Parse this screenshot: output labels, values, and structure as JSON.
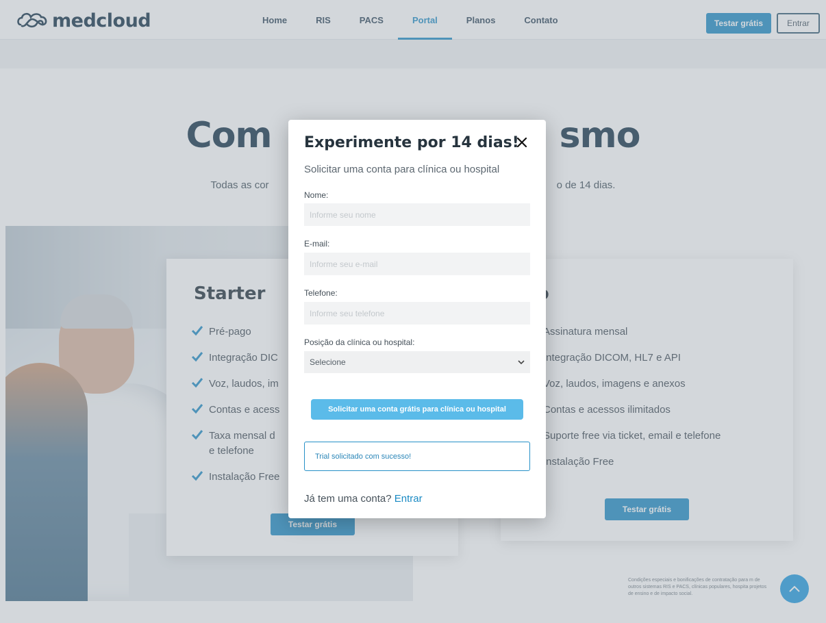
{
  "brand": {
    "name": "medcloud"
  },
  "nav": {
    "items": [
      {
        "label": "Home"
      },
      {
        "label": "RIS"
      },
      {
        "label": "PACS"
      },
      {
        "label": "Portal",
        "active": true
      },
      {
        "label": "Planos"
      },
      {
        "label": "Contato"
      }
    ],
    "trial_label": "Testar grátis",
    "login_label": "Entrar"
  },
  "hero": {
    "title_left": "Com",
    "title_right": "smo",
    "subtitle_left": "Todas as cor",
    "subtitle_right": "o de 14 dias."
  },
  "plans": [
    {
      "title": "Starter",
      "features": [
        "Pré-pago",
        "Integração DIC",
        "Voz, laudos, im",
        "Contas e acess",
        "Taxa mensal d\ne telefone",
        "Instalação Free"
      ],
      "button_label": "Testar grátis"
    },
    {
      "title": "ro",
      "features": [
        "Assinatura mensal",
        "Integração DICOM, HL7 e API",
        "Voz, laudos, imagens e anexos",
        "Contas e acessos ilimitados",
        "Suporte free via ticket, email e telefone",
        "Instalação Free"
      ],
      "button_label": "Testar grátis"
    }
  ],
  "footnote": "Condições especiais e bonificações de contratação para m de outros sistemas RIS e PACS, clínicas populares, hospita projetos de ensino e de impacto social.",
  "modal": {
    "title": "Experimente por 14 dias!",
    "subtitle": "Solicitar uma conta para clínica ou hospital",
    "fields": {
      "name": {
        "label": "Nome:",
        "placeholder": "Informe seu nome",
        "value": ""
      },
      "email": {
        "label": "E-mail:",
        "placeholder": "Informe seu e-mail",
        "value": ""
      },
      "phone": {
        "label": "Telefone:",
        "placeholder": "Informe seu telefone",
        "value": ""
      },
      "position": {
        "label": "Posição da clínica ou hospital:",
        "selected": "Selecione"
      }
    },
    "submit_label": "Solicitar uma conta grátis para clínica ou hospital",
    "success_message": "Trial solicitado com sucesso!",
    "login_prompt": "Já tem uma conta?",
    "login_link": "Entrar"
  },
  "colors": {
    "accent": "#1a8ac4",
    "accent_light": "#5bbbe9",
    "navy": "#0f2d44",
    "overlay": "rgba(150,160,170,0.42)"
  },
  "icons": {
    "logo": "cloud-infinity-icon",
    "close": "close-icon",
    "select": "chevron-down-icon",
    "check": "check-icon",
    "scroll_top": "chevron-up-icon"
  }
}
